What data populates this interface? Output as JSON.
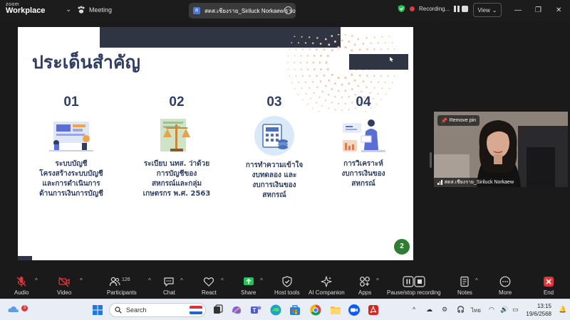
{
  "app": {
    "logo_top": "zoom",
    "logo_bottom": "Workplace",
    "meeting_label": "Meeting",
    "tab_title": "สตส.เชียงราย_Siriluck Norkaew's so",
    "recording_label": "Recording...",
    "view_label": "View"
  },
  "slide": {
    "title": "ประเด็นสำคัญ",
    "page": "2",
    "items": [
      {
        "num": "01",
        "lines": [
          "ระบบบัญชี",
          "โครงสร้างระบบบัญชี",
          "และการดำเนินการ",
          "ด้านการเงินการบัญชี"
        ]
      },
      {
        "num": "02",
        "lines": [
          "ระเบียบ นทส. ว่าด้วย",
          "การบัญชีของ",
          "สหกรณ์และกลุ่ม",
          "เกษตรกร พ.ศ. 2563"
        ]
      },
      {
        "num": "03",
        "lines": [
          "การทำความเข้าใจ",
          "งบทดลอง และ",
          "งบการเงินของ",
          "สหกรณ์"
        ]
      },
      {
        "num": "04",
        "lines": [
          "การวิเคราะห์",
          "งบการเงินของ",
          "สหกรณ์"
        ]
      }
    ]
  },
  "video": {
    "remove_pin": "Remove pin",
    "name": "สตส.เชียงราย_Siriluck Norkaew"
  },
  "toolbar": {
    "audio": "Audio",
    "video": "Video",
    "participants": "Participants",
    "participants_count": "126",
    "chat": "Chat",
    "react": "React",
    "share": "Share",
    "host_tools": "Host tools",
    "ai_companion": "AI Companion",
    "apps": "Apps",
    "pause_stop": "Pause/stop recording",
    "notes": "Notes",
    "more": "More",
    "end": "End"
  },
  "taskbar": {
    "weather_badge": "3",
    "search_placeholder": "Search",
    "lang": "ไทย",
    "time": "13:15",
    "date": "19/6/2568"
  },
  "colors": {
    "slide_title": "#2f3e62",
    "slide_bar": "#2f3542",
    "page_badge": "#2e7d32",
    "share_green": "#23c552",
    "end_red": "#e0353b",
    "dots_orange": "#f3c9a5"
  }
}
